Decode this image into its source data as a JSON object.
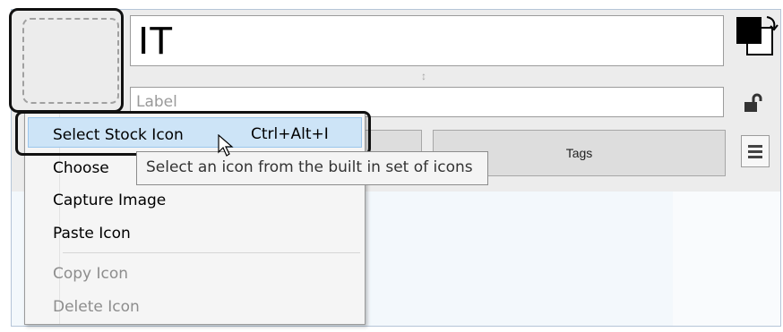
{
  "editor": {
    "title_value": "IT",
    "label_placeholder": "Label",
    "tags_button": "Tags"
  },
  "icons": {
    "color_swap": "color-swap-icon",
    "lock": "unlock-icon",
    "menu": "hamburger-menu-icon",
    "resize": "resize-grip-icon"
  },
  "context_menu": {
    "items": [
      {
        "label": "Select Stock Icon",
        "shortcut": "Ctrl+Alt+I",
        "enabled": true,
        "selected": true
      },
      {
        "label": "Choose",
        "enabled": true
      },
      {
        "label": "Capture Image",
        "enabled": true
      },
      {
        "label": "Paste Icon",
        "enabled": true
      },
      {
        "label": "Copy Icon",
        "enabled": false
      },
      {
        "label": "Delete Icon",
        "enabled": false
      }
    ]
  },
  "tooltip": {
    "text": "Select an icon from the built in set of icons"
  },
  "colors": {
    "selection_bg": "#cde4f7",
    "selection_border": "#9ac5ec",
    "panel_border": "#b5c5d8"
  }
}
